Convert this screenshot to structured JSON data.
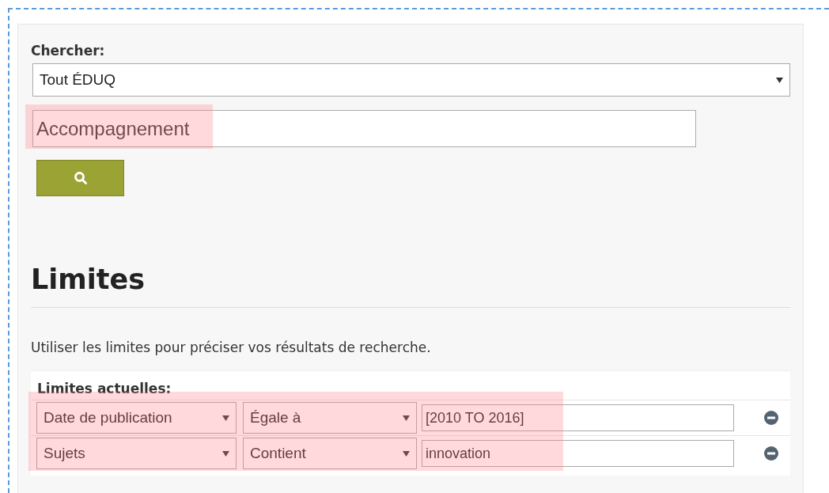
{
  "search": {
    "label": "Chercher:",
    "scope": "Tout ÉDUQ",
    "query": "Accompagnement",
    "query_highlighted": true
  },
  "limits": {
    "heading": "Limites",
    "description": "Utiliser les limites pour préciser vos résultats de recherche.",
    "current_label": "Limites actuelles:",
    "rows_highlighted": true,
    "rows": [
      {
        "field": "Date de publication",
        "operator": "Égale à",
        "value": "[2010 TO 2016]"
      },
      {
        "field": "Sujets",
        "operator": "Contient",
        "value": "innovation"
      }
    ]
  }
}
